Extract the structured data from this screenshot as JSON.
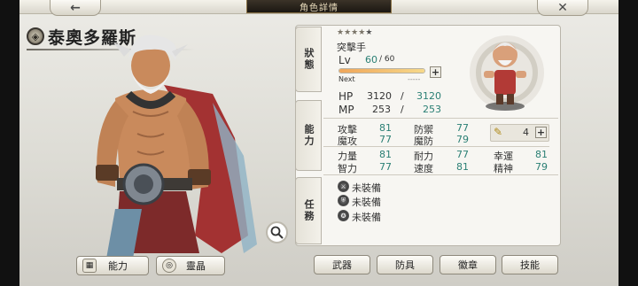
{
  "header": {
    "title": "角色詳情",
    "back_glyph": "←",
    "close_glyph": "✕"
  },
  "character": {
    "name": "泰奧多羅斯",
    "emblem_icon": "shield-emblem-icon",
    "stars_total": 5,
    "stars_filled": 4,
    "class": "突擊手",
    "level_label": "Lv",
    "level": "60",
    "level_max": "/ 60",
    "level_progress": 1.0,
    "next_label": "Next",
    "next_value": "-----",
    "hp_label": "HP",
    "hp": "3120",
    "hp_sep": "/",
    "hp_max": "3120",
    "mp_label": "MP",
    "mp": "253",
    "mp_sep": "/",
    "mp_max": "253"
  },
  "tabs": {
    "status": "狀態",
    "ability": "能力",
    "task": "任務"
  },
  "stats": [
    {
      "label": "攻擊",
      "value": "81"
    },
    {
      "label": "防禦",
      "value": "77"
    },
    {
      "label": "魔攻",
      "value": "77"
    },
    {
      "label": "魔防",
      "value": "79"
    },
    {
      "label": "力量",
      "value": "81"
    },
    {
      "label": "耐力",
      "value": "77"
    },
    {
      "label": "幸運",
      "value": "81"
    },
    {
      "label": "智力",
      "value": "77"
    },
    {
      "label": "速度",
      "value": "81"
    },
    {
      "label": "精神",
      "value": "79"
    }
  ],
  "stat_points": {
    "icon": "feather-icon",
    "value": "4"
  },
  "equipment": [
    {
      "icon": "equip-slot-1-icon",
      "label": "未裝備"
    },
    {
      "icon": "equip-slot-2-icon",
      "label": "未裝備"
    },
    {
      "icon": "equip-slot-3-icon",
      "label": "未裝備"
    }
  ],
  "bottom_left": {
    "ability_btn": "能力",
    "spirit_btn": "靈晶"
  },
  "bottom_tabs": [
    "武器",
    "防具",
    "徽章",
    "技能"
  ],
  "colors": {
    "accent_teal": "#2a7f74",
    "title_bar": "#2b241b"
  }
}
